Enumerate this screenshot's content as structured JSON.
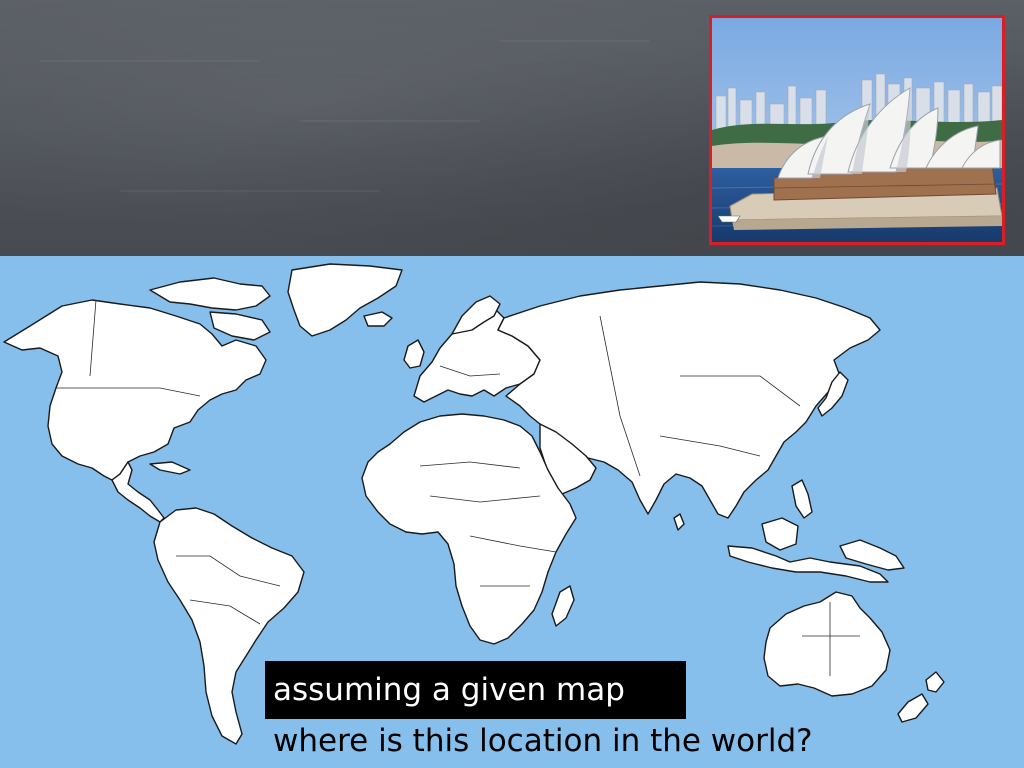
{
  "slide": {
    "caption_boxed": "assuming a given map",
    "caption_question": "where is this location in the world?"
  },
  "photo": {
    "subject": "opera-house-photo",
    "frame_color": "#d81f26"
  },
  "map": {
    "ocean_color": "#86bfeb",
    "land_color": "#ffffff",
    "border_color": "#1a1a1a"
  },
  "colors": {
    "slate": "#4f535a",
    "caption_box_bg": "#000000",
    "caption_box_text": "#ffffff",
    "caption_text": "#000000"
  }
}
